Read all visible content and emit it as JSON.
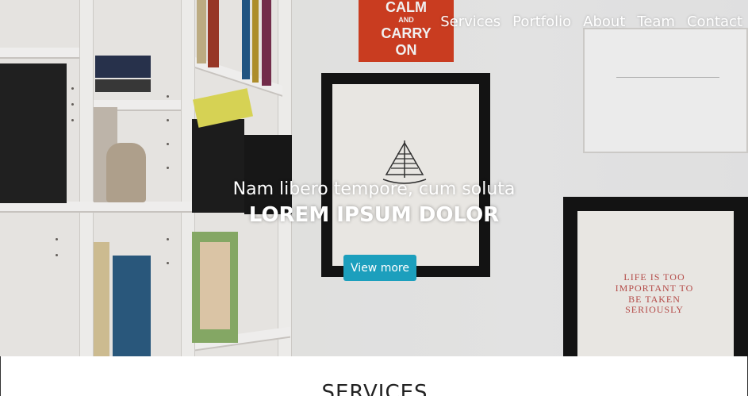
{
  "nav": {
    "items": [
      {
        "label": "Services"
      },
      {
        "label": "Portfolio"
      },
      {
        "label": "About"
      },
      {
        "label": "Team"
      },
      {
        "label": "Contact"
      }
    ]
  },
  "hero": {
    "subtitle": "Nam libero tempore, cum soluta",
    "title": "LOREM IPSUM DOLOR",
    "button_label": "View more",
    "poster_lines": [
      "CALM",
      "AND",
      "CARRY",
      "ON"
    ],
    "frame_quote": "LIFE IS TOO IMPORTANT TO BE TAKEN SERIOUSLY"
  },
  "services": {
    "title": "SERVICES"
  },
  "colors": {
    "accent": "#1c9fbd",
    "poster": "#d64022"
  }
}
